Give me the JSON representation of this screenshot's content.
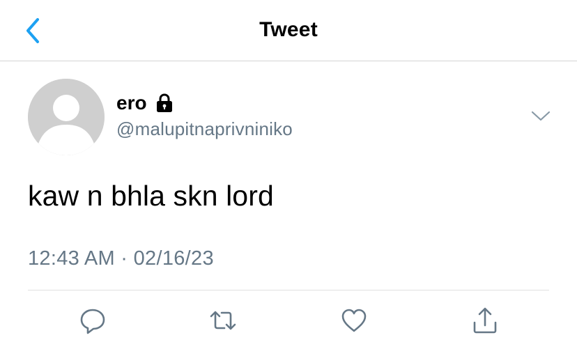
{
  "header": {
    "title": "Tweet",
    "back_icon": "chevron-left-icon"
  },
  "tweet": {
    "display_name": "ero",
    "protected_icon": "lock-icon",
    "handle": "@malupitnaprivniniko",
    "text": "kaw n bhla skn lord",
    "timestamp": "12:43 AM · 02/16/23",
    "menu_icon": "chevron-down-icon"
  },
  "actions": [
    {
      "name": "reply",
      "icon": "comment-icon"
    },
    {
      "name": "retweet",
      "icon": "retweet-icon"
    },
    {
      "name": "like",
      "icon": "heart-icon"
    },
    {
      "name": "share",
      "icon": "share-icon"
    }
  ],
  "colors": {
    "accent": "#1da1f2",
    "secondary_text": "#657786",
    "icon_gray": "#657786",
    "divider": "#e1e1e1"
  }
}
